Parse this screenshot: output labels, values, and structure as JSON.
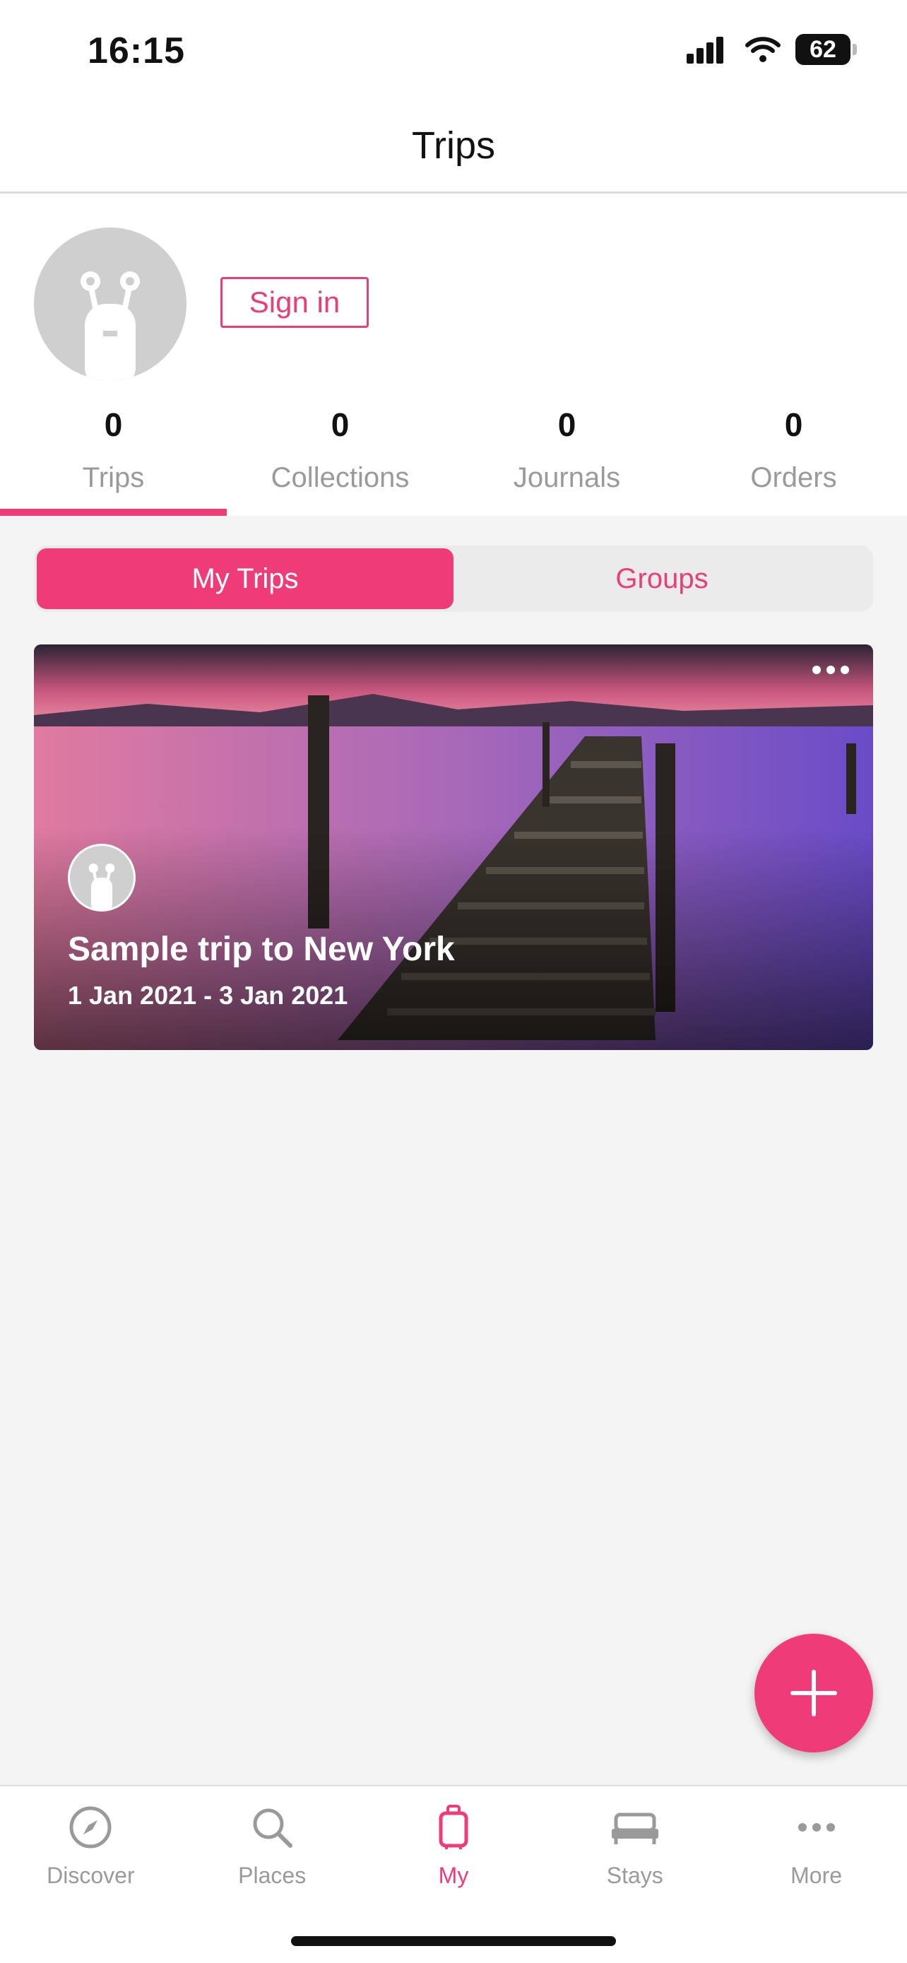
{
  "status_bar": {
    "time": "16:15",
    "battery": "62"
  },
  "header": {
    "title": "Trips"
  },
  "profile": {
    "sign_in_label": "Sign in",
    "stats": [
      {
        "count": "0",
        "label": "Trips"
      },
      {
        "count": "0",
        "label": "Collections"
      },
      {
        "count": "0",
        "label": "Journals"
      },
      {
        "count": "0",
        "label": "Orders"
      }
    ]
  },
  "segment": {
    "my_trips": "My Trips",
    "groups": "Groups"
  },
  "trip": {
    "title": "Sample trip to New York",
    "dates": "1 Jan 2021 - 3 Jan 2021"
  },
  "nav": [
    {
      "label": "Discover",
      "icon": "compass-icon"
    },
    {
      "label": "Places",
      "icon": "search-icon"
    },
    {
      "label": "My",
      "icon": "luggage-icon"
    },
    {
      "label": "Stays",
      "icon": "bed-icon"
    },
    {
      "label": "More",
      "icon": "more-icon"
    }
  ],
  "colors": {
    "accent": "#ef3c78",
    "muted": "#9a9a9a"
  }
}
